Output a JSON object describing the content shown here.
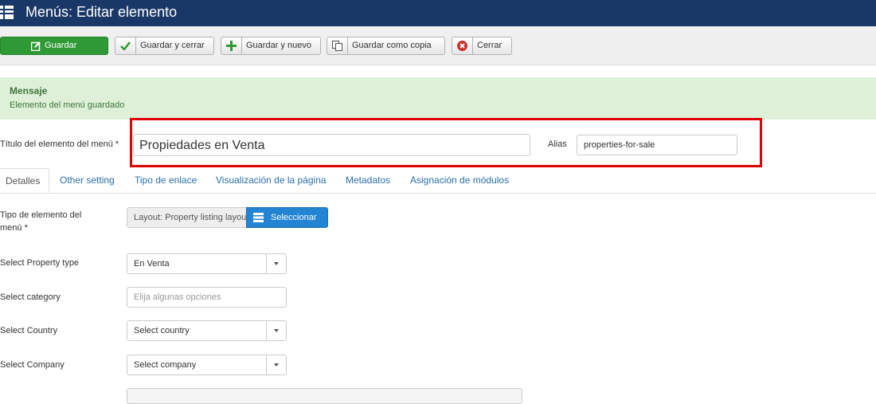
{
  "header": {
    "title": "Menús: Editar elemento",
    "icon": "menu-icon",
    "bg": "#1a3867"
  },
  "toolbar": {
    "save": "Guardar",
    "save_close": "Guardar y cerrar",
    "save_new": "Guardar y nuevo",
    "save_copy": "Guardar como copia",
    "close": "Cerrar"
  },
  "message": {
    "heading": "Mensaje",
    "text": "Elemento del menú guardado"
  },
  "form": {
    "title_label": "Título del elemento del menú *",
    "title_value": "Propiedades en Venta",
    "alias_label": "Alias",
    "alias_value": "properties-for-sale"
  },
  "tabs": [
    "Detalles",
    "Other setting",
    "Tipo de enlace",
    "Visualización de la página",
    "Metadatos",
    "Asignación de módulos"
  ],
  "fields": {
    "type_label_1": "Tipo de elemento del",
    "type_label_2": "menú *",
    "type_value": "Layout: Property listing layout",
    "select_button": "Seleccionar",
    "property_type_label": "Select Property type",
    "property_type_value": "En Venta",
    "category_label": "Select category",
    "category_placeholder": "Elija algunas opciones",
    "country_label": "Select Country",
    "country_value": "Select country",
    "company_label": "Select Company",
    "company_value": "Select company"
  },
  "colors": {
    "save_green": "#2f9a35",
    "accent_blue": "#2384d3",
    "highlight_red": "#e00000",
    "message_bg": "#dff0d8"
  }
}
